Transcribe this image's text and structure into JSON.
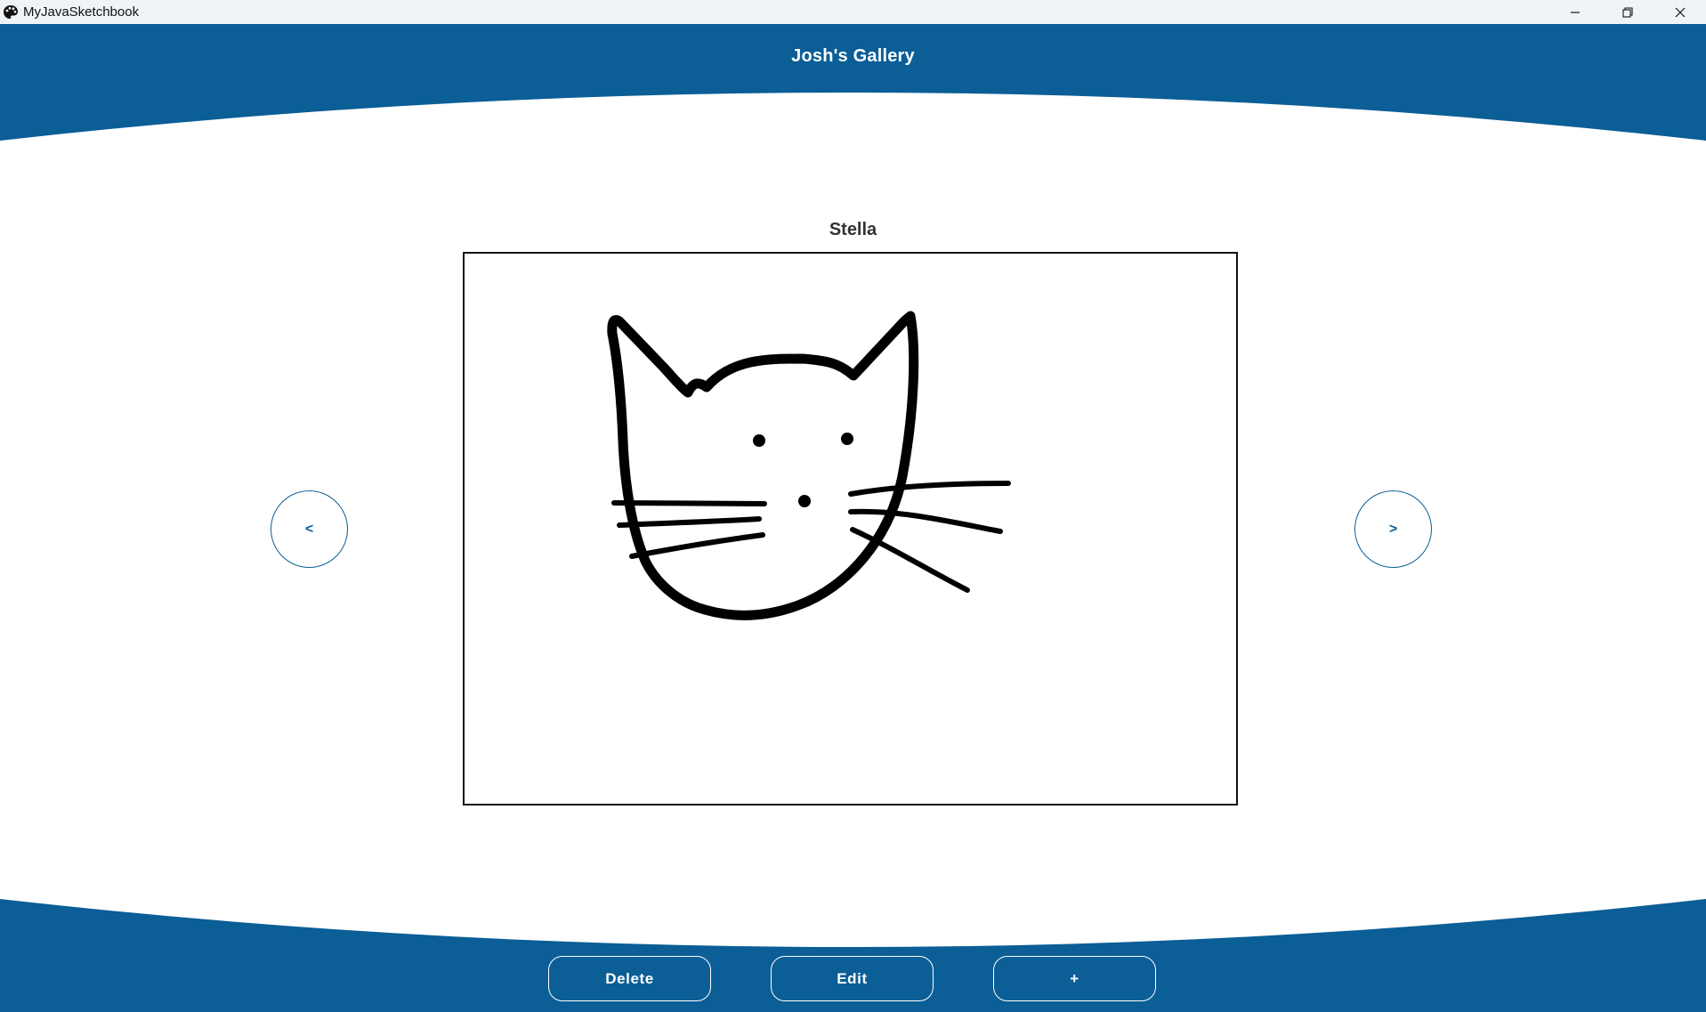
{
  "window": {
    "title": "MyJavaSketchbook",
    "controls": [
      "minimize-icon",
      "restore-icon",
      "close-icon"
    ]
  },
  "header": {
    "title": "Josh's Gallery"
  },
  "sketch": {
    "title": "Stella",
    "image": "cat-face-drawing"
  },
  "navigation": {
    "prev_label": "<",
    "next_label": ">"
  },
  "footer": {
    "delete_label": "Delete",
    "edit_label": "Edit",
    "add_label": "+"
  },
  "colors": {
    "primary": "#0b5e96",
    "background": "#ffffff",
    "titlebar": "#f0f4f9"
  }
}
